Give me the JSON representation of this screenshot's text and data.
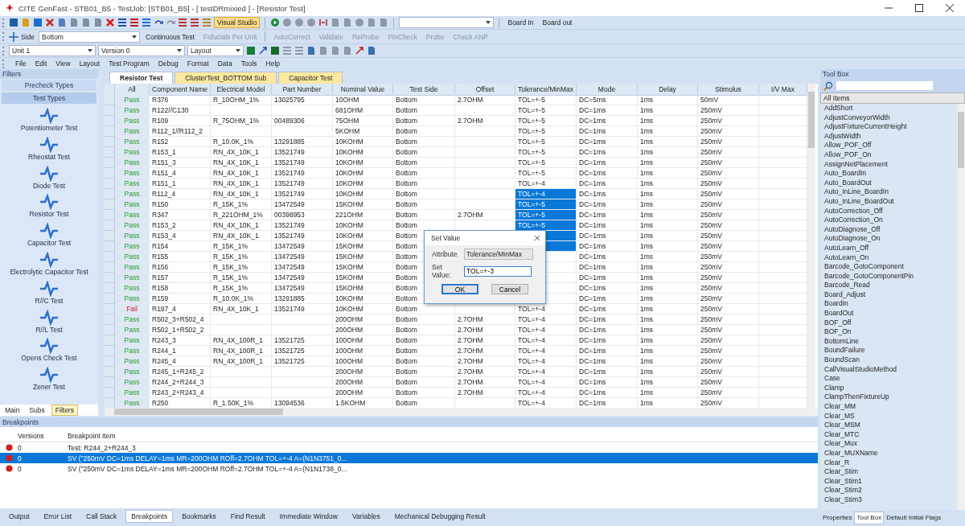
{
  "window": {
    "title": "CITE GenFast - STB01_B5 - TestJob: [STB01_B5] - [ testDRmixied ] - [Resistor Test]"
  },
  "toolbar": {
    "visual_studio": {
      "label": "Visual Studio",
      "selected": true
    },
    "board_in": "Board In",
    "board_out": "Board out",
    "side_label": "Side",
    "side_value": "Bottom",
    "continuous_test": "Continuous Test",
    "fiducials": {
      "label": "Fiducials Per Unit",
      "disabled": true
    },
    "tools": [
      {
        "label": "AutoCorrect",
        "disabled": true
      },
      {
        "label": "Validate",
        "disabled": true
      },
      {
        "label": "ReProbe",
        "disabled": true
      },
      {
        "label": "PinCheck",
        "disabled": true
      },
      {
        "label": "Probe",
        "disabled": true
      },
      {
        "label": "Check ANP",
        "disabled": true
      }
    ],
    "unit": "Unit 1",
    "version": "Version 0",
    "layout": "Layout"
  },
  "menu": [
    "File",
    "Edit",
    "View",
    "Layout",
    "Test Program",
    "Debug",
    "Format",
    "Data",
    "Tools",
    "Help"
  ],
  "filters": {
    "title": "Filters",
    "sections": [
      {
        "label": "Precheck Types",
        "selected": false
      },
      {
        "label": "Test Types",
        "selected": true
      }
    ],
    "items": [
      "Potentiometer Test",
      "Rheostat Test",
      "Diode Test",
      "Resistor Test",
      "Capacitor Test",
      "Electrolytic Capacitor Test",
      "R//C Test",
      "R//L Test",
      "Opens Check Test",
      "Zener Test"
    ],
    "tabs": [
      {
        "label": "Main",
        "selected": false
      },
      {
        "label": "Subs",
        "selected": false
      },
      {
        "label": "Filters",
        "selected": true
      }
    ]
  },
  "doc_tabs": [
    {
      "label": "Resistor Test",
      "selected": true
    },
    {
      "label": "ClusterTest_BOTTOM Sub",
      "selected": false
    },
    {
      "label": "Capacitor Test",
      "selected": false
    }
  ],
  "table": {
    "columns": [
      "All",
      "Component Name",
      "Electrical Model",
      "Part Number",
      "Nominal Value",
      "Test Side",
      "Offset",
      "Tolerance/MinMax",
      "Mode",
      "Delay",
      "Stimulus",
      "I/V Max"
    ],
    "rows": [
      {
        "all": "Pass",
        "failed": false,
        "component": "R376",
        "model": "R_10OHM_1%",
        "part": "13025795",
        "nominal": "10OHM",
        "side": "Bottom",
        "offset": "2.7OHM",
        "tolerance": "TOL=+-5",
        "selected": false,
        "mode": "DC=5ms",
        "delay": "1ms",
        "stimulus": "50mV"
      },
      {
        "all": "Pass",
        "failed": false,
        "component": "R122//C130",
        "nominal": "681OHM",
        "side": "Bottom",
        "tolerance": "TOL=+-5",
        "selected": false,
        "mode": "DC=1ms",
        "delay": "1ms",
        "stimulus": "250mV"
      },
      {
        "all": "Pass",
        "failed": false,
        "component": "R109",
        "model": "R_75OHM_1%",
        "part": "00489306",
        "nominal": "75OHM",
        "side": "Bottom",
        "offset": "2.7OHM",
        "tolerance": "TOL=+-5",
        "selected": false,
        "mode": "DC=1ms",
        "delay": "1ms",
        "stimulus": "250mV"
      },
      {
        "all": "Pass",
        "failed": false,
        "component": "R112_1//R112_2",
        "nominal": "5KOHM",
        "side": "Bottom",
        "tolerance": "TOL=+-5",
        "selected": false,
        "mode": "DC=1ms",
        "delay": "1ms",
        "stimulus": "250mV"
      },
      {
        "all": "Pass",
        "failed": false,
        "component": "R152",
        "model": "R_10.0K_1%",
        "part": "13291885",
        "nominal": "10KOHM",
        "side": "Bottom",
        "tolerance": "TOL=+-5",
        "selected": false,
        "mode": "DC=1ms",
        "delay": "1ms",
        "stimulus": "250mV"
      },
      {
        "all": "Pass",
        "failed": false,
        "component": "R153_1",
        "model": "RN_4X_10K_1",
        "part": "13521749",
        "nominal": "10KOHM",
        "side": "Bottom",
        "tolerance": "TOL=+-5",
        "selected": false,
        "mode": "DC=1ms",
        "delay": "1ms",
        "stimulus": "250mV"
      },
      {
        "all": "Pass",
        "failed": false,
        "component": "R151_3",
        "model": "RN_4X_10K_1",
        "part": "13521749",
        "nominal": "10KOHM",
        "side": "Bottom",
        "tolerance": "TOL=+-5",
        "selected": false,
        "mode": "DC=1ms",
        "delay": "1ms",
        "stimulus": "250mV"
      },
      {
        "all": "Pass",
        "failed": false,
        "component": "R151_4",
        "model": "RN_4X_10K_1",
        "part": "13521749",
        "nominal": "10KOHM",
        "side": "Bottom",
        "tolerance": "TOL=+-5",
        "selected": false,
        "mode": "DC=1ms",
        "delay": "1ms",
        "stimulus": "250mV"
      },
      {
        "all": "Pass",
        "failed": false,
        "component": "R151_1",
        "model": "RN_4X_10K_1",
        "part": "13521749",
        "nominal": "10KOHM",
        "side": "Bottom",
        "tolerance": "TOL=+-4",
        "selected": false,
        "mode": "DC=1ms",
        "delay": "1ms",
        "stimulus": "250mV"
      },
      {
        "all": "Pass",
        "failed": false,
        "component": "R112_4",
        "model": "RN_4X_10K_1",
        "part": "13521749",
        "nominal": "10KOHM",
        "side": "Bottom",
        "tolerance": "TOL=+-4",
        "selected": true,
        "mode": "DC=1ms",
        "delay": "1ms",
        "stimulus": "250mV"
      },
      {
        "all": "Pass",
        "failed": false,
        "component": "R150",
        "model": "R_15K_1%",
        "part": "13472549",
        "nominal": "15KOHM",
        "side": "Bottom",
        "tolerance": "TOL=+-5",
        "selected": true,
        "mode": "DC=1ms",
        "delay": "1ms",
        "stimulus": "250mV"
      },
      {
        "all": "Pass",
        "failed": false,
        "component": "R347",
        "model": "R_221OHM_1%",
        "part": "00398953",
        "nominal": "221OHM",
        "side": "Bottom",
        "offset": "2.7OHM",
        "tolerance": "TOL=+-5",
        "selected": true,
        "mode": "DC=1ms",
        "delay": "1ms",
        "stimulus": "250mV"
      },
      {
        "all": "Pass",
        "failed": false,
        "component": "R153_2",
        "model": "RN_4X_10K_1",
        "part": "13521749",
        "nominal": "10KOHM",
        "side": "Bottom",
        "tolerance": "TOL=+-5",
        "selected": true,
        "mode": "DC=1ms",
        "delay": "1ms",
        "stimulus": "250mV"
      },
      {
        "all": "Pass",
        "failed": false,
        "component": "R153_4",
        "model": "RN_4X_10K_1",
        "part": "13521749",
        "nominal": "10KOHM",
        "side": "Bottom",
        "selected": true,
        "mode": "DC=1ms",
        "delay": "1ms",
        "stimulus": "250mV"
      },
      {
        "all": "Pass",
        "failed": false,
        "component": "R154",
        "model": "R_15K_1%",
        "part": "13472549",
        "nominal": "15KOHM",
        "side": "Bottom",
        "selected": true,
        "mode": "DC=1ms",
        "delay": "1ms",
        "stimulus": "250mV"
      },
      {
        "all": "Pass",
        "failed": false,
        "component": "R155",
        "model": "R_15K_1%",
        "part": "13472549",
        "nominal": "15KOHM",
        "side": "Bottom",
        "selected": false,
        "mode": "DC=1ms",
        "delay": "1ms",
        "stimulus": "250mV"
      },
      {
        "all": "Pass",
        "failed": false,
        "component": "R156",
        "model": "R_15K_1%",
        "part": "13472549",
        "nominal": "15KOHM",
        "side": "Bottom",
        "selected": false,
        "mode": "DC=1ms",
        "delay": "1ms",
        "stimulus": "250mV"
      },
      {
        "all": "Pass",
        "failed": false,
        "component": "R157",
        "model": "R_15K_1%",
        "part": "13472549",
        "nominal": "15KOHM",
        "side": "Bottom",
        "selected": false,
        "mode": "DC=1ms",
        "delay": "1ms",
        "stimulus": "250mV"
      },
      {
        "all": "Pass",
        "failed": false,
        "component": "R158",
        "model": "R_15K_1%",
        "part": "13472549",
        "nominal": "15KOHM",
        "side": "Bottom",
        "selected": false,
        "mode": "DC=1ms",
        "delay": "1ms",
        "stimulus": "250mV"
      },
      {
        "all": "Pass",
        "failed": false,
        "component": "R159",
        "model": "R_10.0K_1%",
        "part": "13291885",
        "nominal": "10KOHM",
        "side": "Bottom",
        "selected": false,
        "mode": "DC=1ms",
        "delay": "1ms",
        "stimulus": "250mV"
      },
      {
        "all": "Fail",
        "failed": true,
        "component": "R197_4",
        "model": "RN_4X_10K_1",
        "part": "13521749",
        "nominal": "10KOHM",
        "side": "Bottom",
        "tolerance": "TOL=+-4",
        "selected": false,
        "mode": "DC=1ms",
        "delay": "1ms",
        "stimulus": "250mV"
      },
      {
        "all": "Pass",
        "failed": false,
        "component": "R502_3+R502_4",
        "nominal": "200OHM",
        "side": "Bottom",
        "offset": "2.7OHM",
        "tolerance": "TOL=+-4",
        "selected": false,
        "mode": "DC=1ms",
        "delay": "1ms",
        "stimulus": "250mV"
      },
      {
        "all": "Pass",
        "failed": false,
        "component": "R502_1+R502_2",
        "nominal": "200OHM",
        "side": "Bottom",
        "offset": "2.7OHM",
        "tolerance": "TOL=+-4",
        "selected": false,
        "mode": "DC=1ms",
        "delay": "1ms",
        "stimulus": "250mV"
      },
      {
        "all": "Pass",
        "failed": false,
        "component": "R243_3",
        "model": "RN_4X_100R_1",
        "part": "13521725",
        "nominal": "100OHM",
        "side": "Bottom",
        "offset": "2.7OHM",
        "tolerance": "TOL=+-4",
        "selected": false,
        "mode": "DC=1ms",
        "delay": "1ms",
        "stimulus": "250mV"
      },
      {
        "all": "Pass",
        "failed": false,
        "component": "R244_1",
        "model": "RN_4X_100R_1",
        "part": "13521725",
        "nominal": "100OHM",
        "side": "Bottom",
        "offset": "2.7OHM",
        "tolerance": "TOL=+-4",
        "selected": false,
        "mode": "DC=1ms",
        "delay": "1ms",
        "stimulus": "250mV"
      },
      {
        "all": "Pass",
        "failed": false,
        "component": "R245_4",
        "model": "RN_4X_100R_1",
        "part": "13521725",
        "nominal": "100OHM",
        "side": "Bottom",
        "offset": "2.7OHM",
        "tolerance": "TOL=+-4",
        "selected": false,
        "mode": "DC=1ms",
        "delay": "1ms",
        "stimulus": "250mV"
      },
      {
        "all": "Pass",
        "failed": false,
        "component": "R245_1+R245_2",
        "nominal": "200OHM",
        "side": "Bottom",
        "offset": "2.7OHM",
        "tolerance": "TOL=+-4",
        "selected": false,
        "mode": "DC=1ms",
        "delay": "1ms",
        "stimulus": "250mV"
      },
      {
        "all": "Pass",
        "failed": false,
        "component": "R244_2+R244_3",
        "nominal": "200OHM",
        "side": "Bottom",
        "offset": "2.7OHM",
        "tolerance": "TOL=+-4",
        "selected": false,
        "mode": "DC=1ms",
        "delay": "1ms",
        "stimulus": "250mV"
      },
      {
        "all": "Pass",
        "failed": false,
        "component": "R243_2+R243_4",
        "nominal": "200OHM",
        "side": "Bottom",
        "offset": "2.7OHM",
        "tolerance": "TOL=+-4",
        "selected": false,
        "mode": "DC=1ms",
        "delay": "1ms",
        "stimulus": "250mV"
      },
      {
        "all": "Pass",
        "failed": false,
        "component": "R250",
        "model": "R_1.50K_1%",
        "part": "13094536",
        "nominal": "1.5KOHM",
        "side": "Bottom",
        "tolerance": "TOL=+-4",
        "selected": false,
        "mode": "DC=1ms",
        "delay": "1ms",
        "stimulus": "250mV"
      }
    ]
  },
  "dialog": {
    "title": "Set Value",
    "attribute_label": "Attribute",
    "attribute_value": "Tolerance/MinMax",
    "value_label": "Set Value:",
    "value": "TOL=+-3",
    "ok": "OK",
    "cancel": "Cancel"
  },
  "breakpoints": {
    "title": "Breakpoints",
    "columns": [
      "Versions",
      "Breakpoint Item"
    ],
    "rows": [
      {
        "version": "0",
        "item": "Test: R244_2+R244_3",
        "selected": false
      },
      {
        "version": "0",
        "item": "SV (\"250mV DC=1ms DELAY=1ms MR=200OHM ROff=2.7OHM TOL=+-4 A=(N1N3751_0...",
        "selected": true
      },
      {
        "version": "0",
        "item": "SV (\"250mV DC=1ms DELAY=1ms MR=200OHM ROff=2.7OHM TOL=+-4 A=(N1N1738_0...",
        "selected": false
      }
    ]
  },
  "bottom_tabs": [
    {
      "label": "Output",
      "selected": false
    },
    {
      "label": "Error List",
      "selected": false
    },
    {
      "label": "Call Stack",
      "selected": false
    },
    {
      "label": "Breakpoints",
      "selected": true
    },
    {
      "label": "Bookmarks",
      "selected": false
    },
    {
      "label": "Find Result",
      "selected": false
    },
    {
      "label": "Immediate Window",
      "selected": false
    },
    {
      "label": "Variables",
      "selected": false
    },
    {
      "label": "Mechanical Debugging Result",
      "selected": false
    }
  ],
  "toolbox": {
    "title": "Tool Box",
    "filter": "All Items",
    "items": [
      "AddShort",
      "AdjustConveyorWidth",
      "AdjustFixtureCurrentHeight",
      "AdjustWidth",
      "Allow_POF_Off",
      "Allow_POF_On",
      "AssignNetPlacement",
      "Auto_BoardIn",
      "Auto_BoardOut",
      "Auto_InLine_BoardIn",
      "Auto_InLine_BoardOut",
      "AutoCorrection_Off",
      "AutoCorrection_On",
      "AutoDiagnose_Off",
      "AutoDiagnose_On",
      "AutoLearn_Off",
      "AutoLearn_On",
      "Barcode_GotoComponent",
      "Barcode_GotoComponentPin",
      "Barcode_Read",
      "Board_Adjust",
      "BoardIn",
      "BoardOut",
      "BOF_Off",
      "BOF_On",
      "BottomLine",
      "BoundFailure",
      "BoundScan",
      "CallVisualStudioMethod",
      "Case",
      "Clamp",
      "ClampThenFixtureUp",
      "Clear_MM",
      "Clear_MS",
      "Clear_MSM",
      "Clear_MTC",
      "Clear_Mux",
      "Clear_MUXName",
      "Clear_R",
      "Clear_Stim",
      "Clear_Stim1",
      "Clear_Stim2",
      "Clear_Stim3"
    ],
    "tabs": [
      {
        "label": "Properties",
        "selected": false
      },
      {
        "label": "Tool Box",
        "selected": true
      },
      {
        "label": "Default Initial Flags",
        "selected": false
      }
    ]
  }
}
